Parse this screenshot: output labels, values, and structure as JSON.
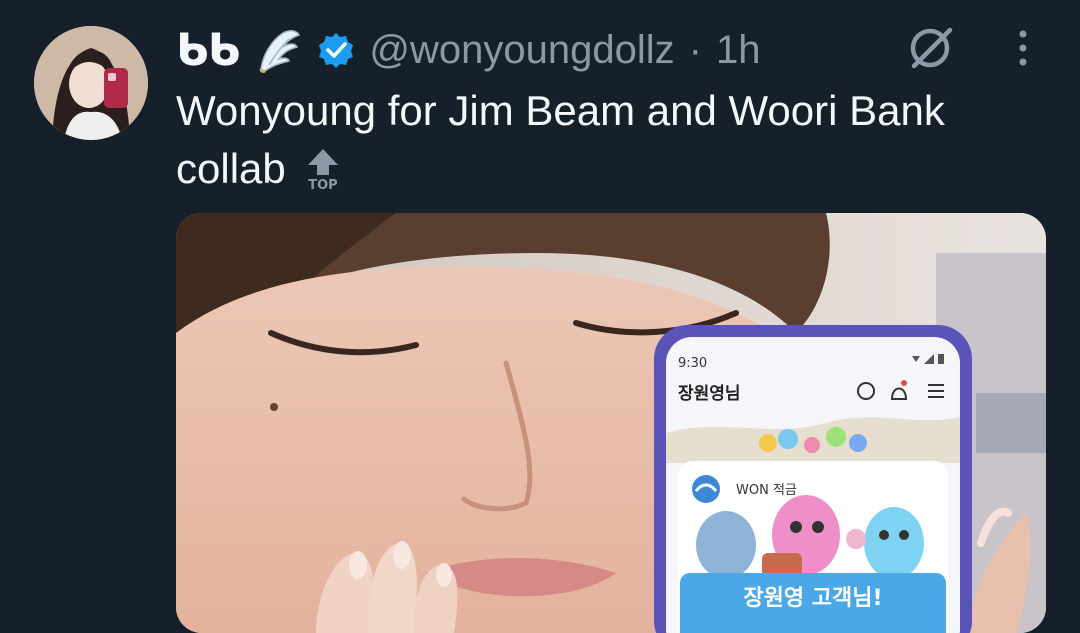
{
  "tweet": {
    "display_name": "ᑲᑲ",
    "handle": "@wonyoungdollz",
    "separator": "·",
    "time": "1h",
    "text": "Wonyoung for Jim Beam and Woori Bank collab",
    "emoji": "TOP"
  },
  "phone": {
    "status_time": "9:30",
    "account_name": "장원영님",
    "card_label": "WON 적금",
    "banner_text": "장원영 고객님!"
  },
  "icons": {
    "wing": "wing-icon",
    "verified": "verified-badge-icon",
    "grok": "grok-icon",
    "more": "more-options-icon",
    "top": "top-arrow-emoji-icon"
  },
  "colors": {
    "background": "#15202b",
    "verified": "#1d9bf0",
    "muted": "#8b98a5",
    "text": "#f5f8fa"
  }
}
